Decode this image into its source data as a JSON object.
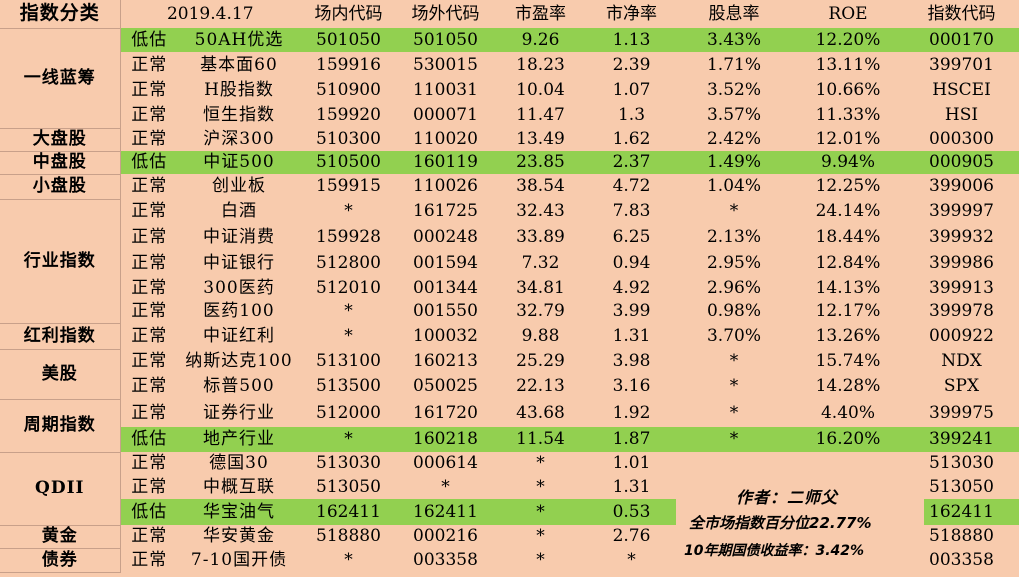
{
  "header": {
    "category": "指数分类",
    "date": "2019.4.17",
    "onsite_code": "场内代码",
    "offsite_code": "场外代码",
    "pe": "市盈率",
    "pb": "市净率",
    "dividend": "股息率",
    "roe": "ROE",
    "index_code": "指数代码"
  },
  "categories": {
    "first_line": "一线蓝筹",
    "large_cap": "大盘股",
    "mid_cap": "中盘股",
    "small_cap": "小盘股",
    "industry": "行业指数",
    "dividend_idx": "红利指数",
    "us_stock": "美股",
    "cyclical": "周期指数",
    "qdii": "QDII",
    "gold": "黄金",
    "bond": "债券"
  },
  "rows": [
    {
      "status": "低估",
      "name": "50AH优选",
      "onsite": "501050",
      "offsite": "501050",
      "pe": "9.26",
      "pb": "1.13",
      "div": "3.43%",
      "roe": "12.20%",
      "code": "000170"
    },
    {
      "status": "正常",
      "name": "基本面60",
      "onsite": "159916",
      "offsite": "530015",
      "pe": "18.23",
      "pb": "2.39",
      "div": "1.71%",
      "roe": "13.11%",
      "code": "399701"
    },
    {
      "status": "正常",
      "name": "H股指数",
      "onsite": "510900",
      "offsite": "110031",
      "pe": "10.04",
      "pb": "1.07",
      "div": "3.52%",
      "roe": "10.66%",
      "code": "HSCEI"
    },
    {
      "status": "正常",
      "name": "恒生指数",
      "onsite": "159920",
      "offsite": "000071",
      "pe": "11.47",
      "pb": "1.3",
      "div": "3.57%",
      "roe": "11.33%",
      "code": "HSI"
    },
    {
      "status": "正常",
      "name": "沪深300",
      "onsite": "510300",
      "offsite": "110020",
      "pe": "13.49",
      "pb": "1.62",
      "div": "2.42%",
      "roe": "12.01%",
      "code": "000300"
    },
    {
      "status": "低估",
      "name": "中证500",
      "onsite": "510500",
      "offsite": "160119",
      "pe": "23.85",
      "pb": "2.37",
      "div": "1.49%",
      "roe": "9.94%",
      "code": "000905"
    },
    {
      "status": "正常",
      "name": "创业板",
      "onsite": "159915",
      "offsite": "110026",
      "pe": "38.54",
      "pb": "4.72",
      "div": "1.04%",
      "roe": "12.25%",
      "code": "399006"
    },
    {
      "status": "正常",
      "name": "白酒",
      "onsite": "*",
      "offsite": "161725",
      "pe": "32.43",
      "pb": "7.83",
      "div": "*",
      "roe": "24.14%",
      "code": "399997"
    },
    {
      "status": "正常",
      "name": "中证消费",
      "onsite": "159928",
      "offsite": "000248",
      "pe": "33.89",
      "pb": "6.25",
      "div": "2.13%",
      "roe": "18.44%",
      "code": "399932"
    },
    {
      "status": "正常",
      "name": "中证银行",
      "onsite": "512800",
      "offsite": "001594",
      "pe": "7.32",
      "pb": "0.94",
      "div": "2.95%",
      "roe": "12.84%",
      "code": "399986"
    },
    {
      "status": "正常",
      "name": "300医药",
      "onsite": "512010",
      "offsite": "001344",
      "pe": "34.81",
      "pb": "4.92",
      "div": "2.96%",
      "roe": "14.13%",
      "code": "399913"
    },
    {
      "status": "正常",
      "name": "医药100",
      "onsite": "*",
      "offsite": "001550",
      "pe": "32.79",
      "pb": "3.99",
      "div": "0.98%",
      "roe": "12.17%",
      "code": "399978"
    },
    {
      "status": "正常",
      "name": "中证红利",
      "onsite": "*",
      "offsite": "100032",
      "pe": "9.88",
      "pb": "1.31",
      "div": "3.70%",
      "roe": "13.26%",
      "code": "000922"
    },
    {
      "status": "正常",
      "name": "纳斯达克100",
      "onsite": "513100",
      "offsite": "160213",
      "pe": "25.29",
      "pb": "3.98",
      "div": "*",
      "roe": "15.74%",
      "code": "NDX"
    },
    {
      "status": "正常",
      "name": "标普500",
      "onsite": "513500",
      "offsite": "050025",
      "pe": "22.13",
      "pb": "3.16",
      "div": "*",
      "roe": "14.28%",
      "code": "SPX"
    },
    {
      "status": "正常",
      "name": "证券行业",
      "onsite": "512000",
      "offsite": "161720",
      "pe": "43.68",
      "pb": "1.92",
      "div": "*",
      "roe": "4.40%",
      "code": "399975"
    },
    {
      "status": "低估",
      "name": "地产行业",
      "onsite": "*",
      "offsite": "160218",
      "pe": "11.54",
      "pb": "1.87",
      "div": "*",
      "roe": "16.20%",
      "code": "399241"
    },
    {
      "status": "正常",
      "name": "德国30",
      "onsite": "513030",
      "offsite": "000614",
      "pe": "*",
      "pb": "1.01",
      "div": "",
      "roe": "",
      "code": "513030"
    },
    {
      "status": "正常",
      "name": "中概互联",
      "onsite": "513050",
      "offsite": "*",
      "pe": "*",
      "pb": "1.31",
      "div": "",
      "roe": "",
      "code": "513050"
    },
    {
      "status": "低估",
      "name": "华宝油气",
      "onsite": "162411",
      "offsite": "162411",
      "pe": "*",
      "pb": "0.53",
      "div": "",
      "roe": "",
      "code": "162411"
    },
    {
      "status": "正常",
      "name": "华安黄金",
      "onsite": "518880",
      "offsite": "000216",
      "pe": "*",
      "pb": "2.76",
      "div": "",
      "roe": "",
      "code": "518880"
    },
    {
      "status": "正常",
      "name": "7-10国开债",
      "onsite": "*",
      "offsite": "003358",
      "pe": "*",
      "pb": "*",
      "div": "",
      "roe": "",
      "code": "003358"
    }
  ],
  "notes": {
    "author": "作者：二师父",
    "market_percentile": "全市场指数百分位22.77%",
    "bond_yield": "10年期国债收益率：3.42%"
  }
}
